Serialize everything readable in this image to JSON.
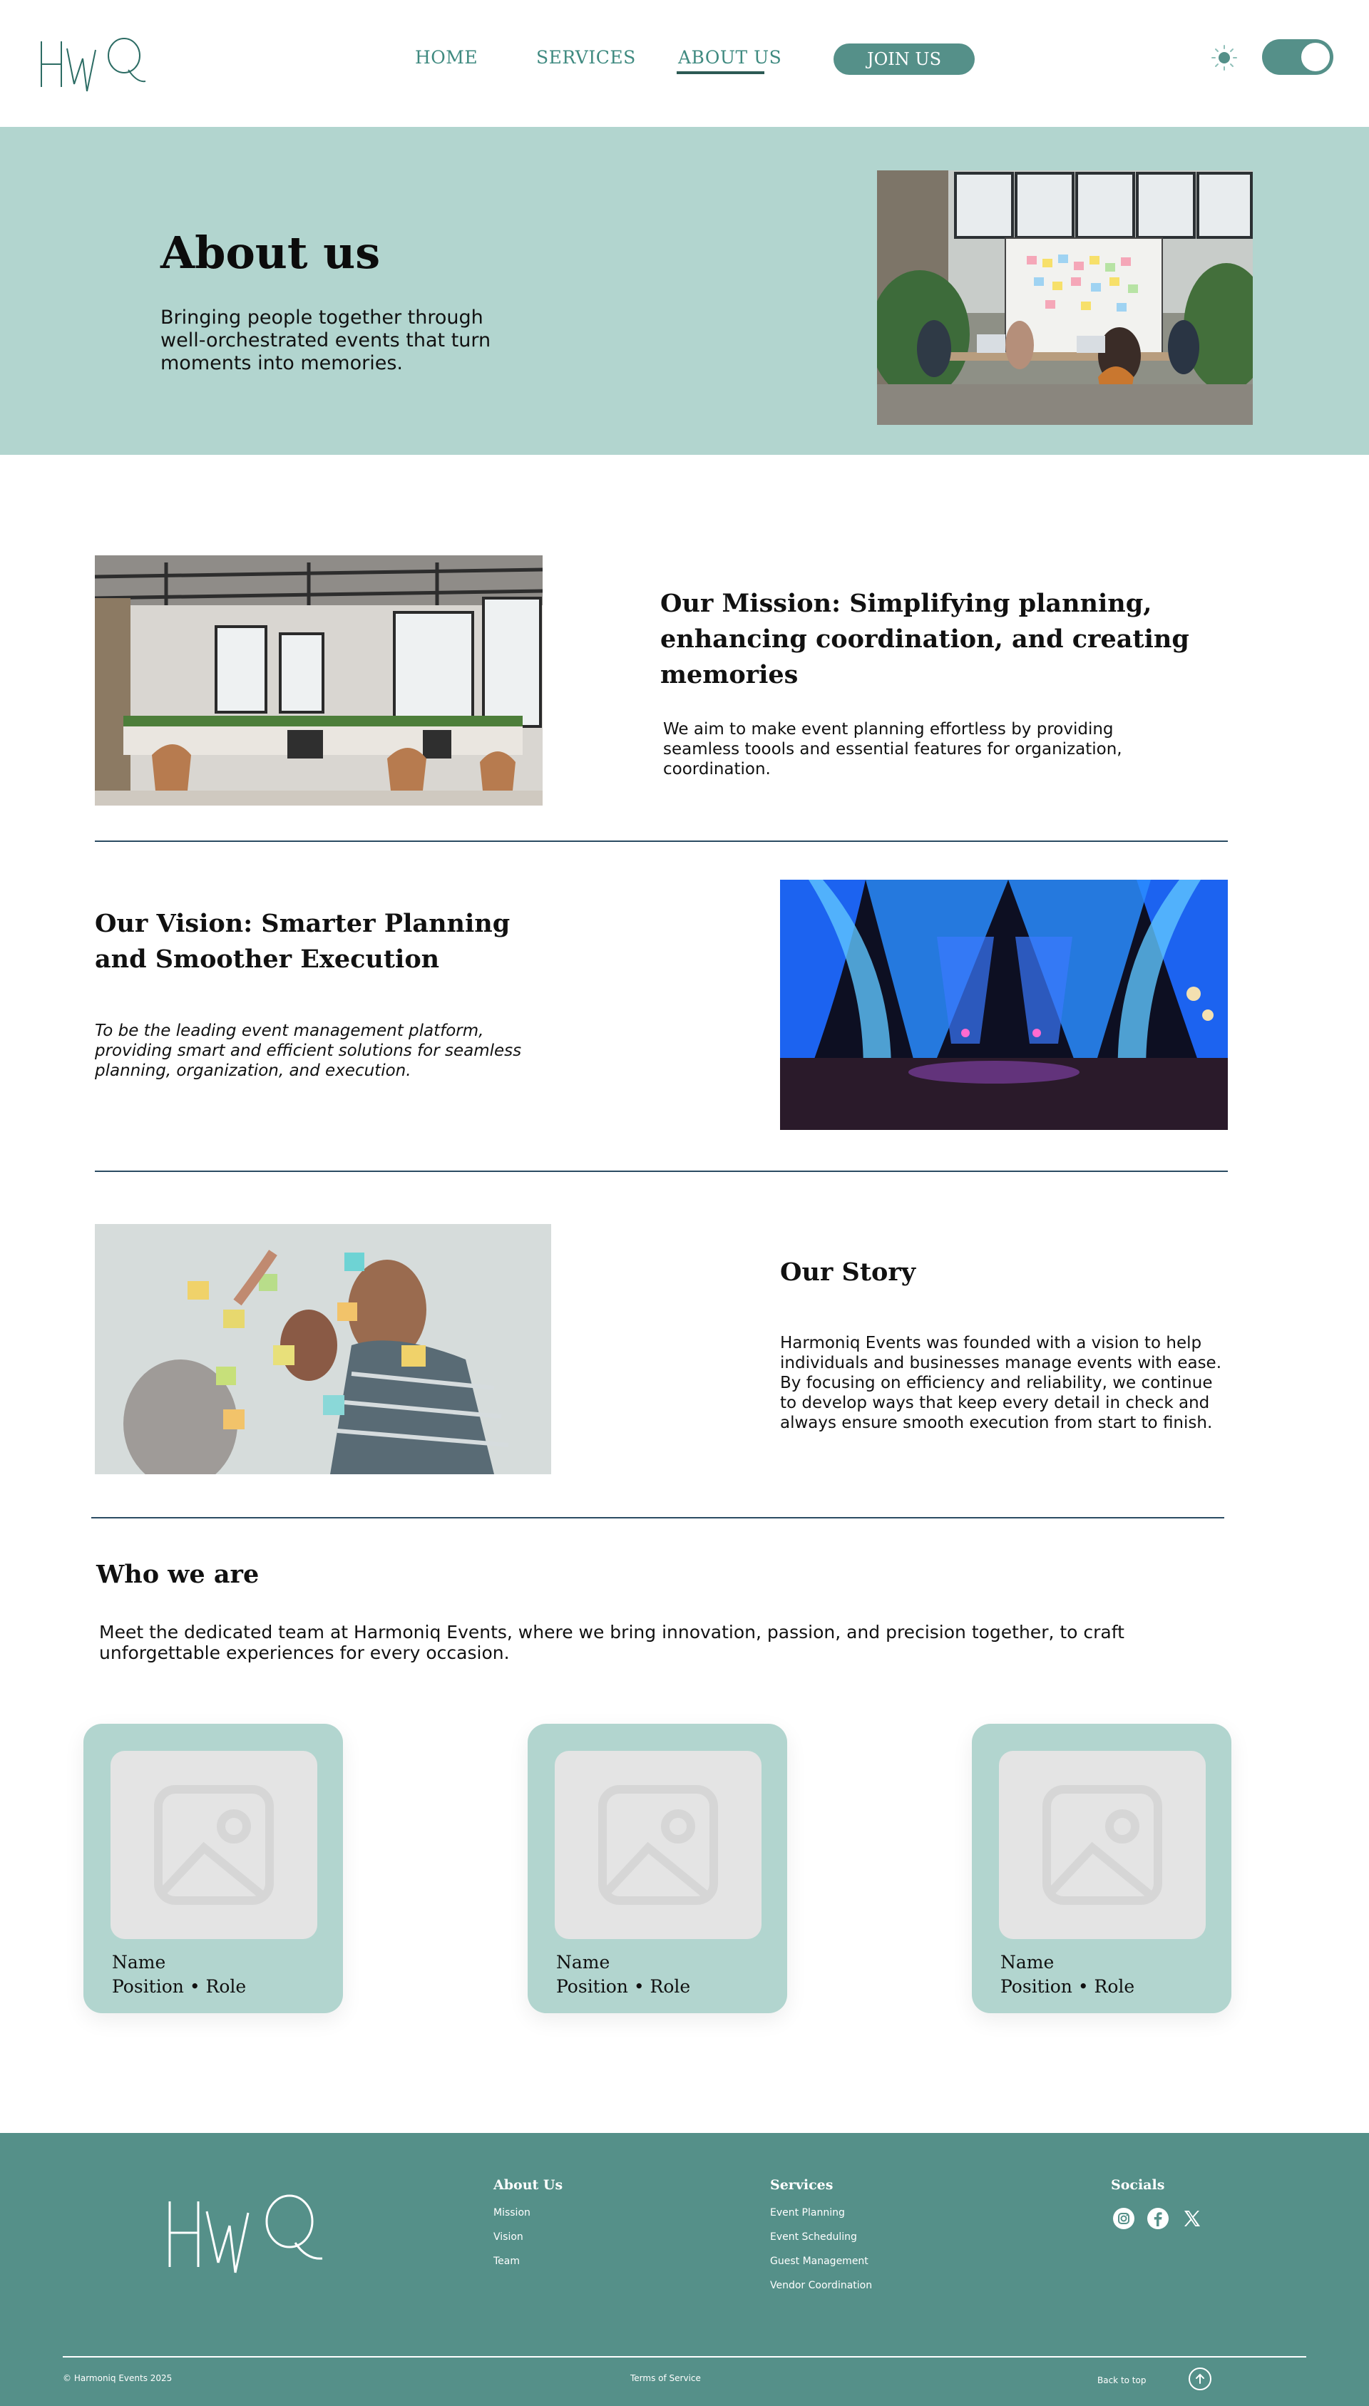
{
  "header": {
    "nav": [
      {
        "label": "HOME"
      },
      {
        "label": "SERVICES"
      },
      {
        "label": "ABOUT US"
      }
    ],
    "join_label": "JOIN US"
  },
  "hero": {
    "title": "About us",
    "subtitle": "Bringing people together through well-orchestrated events that turn moments into memories."
  },
  "mission": {
    "heading": "Our Mission: Simplifying planning, enhancing coordination, and creating memories",
    "text": "We aim to make event planning effortless by providing seamless toools and essential features for organization, coordination."
  },
  "vision": {
    "heading": "Our Vision: Smarter Planning and Smoother Execution",
    "text": "To be the leading event management platform, providing smart and efficient solutions for seamless planning, organization, and execution."
  },
  "story": {
    "heading": "Our Story",
    "text": "Harmoniq Events was founded with a vision to help individuals and businesses manage events with ease. By focusing on efficiency and reliability, we continue to develop ways that keep every detail in check and always ensure smooth execution from start to finish."
  },
  "team": {
    "heading": "Who we are",
    "intro": "Meet the dedicated team at Harmoniq Events, where we bring innovation, passion, and precision together, to craft unforgettable experiences for every occasion.",
    "members": [
      {
        "name": "Name",
        "role": "Position • Role"
      },
      {
        "name": "Name",
        "role": "Position • Role"
      },
      {
        "name": "Name",
        "role": "Position • Role"
      }
    ]
  },
  "footer": {
    "about": {
      "heading": "About Us",
      "links": [
        "Mission",
        "Vision",
        "Team"
      ]
    },
    "services": {
      "heading": "Services",
      "links": [
        "Event Planning",
        "Event Scheduling",
        "Guest Management",
        "Vendor Coordination"
      ]
    },
    "socials": {
      "heading": "Socials",
      "icons": [
        "instagram-icon",
        "facebook-icon",
        "x-icon"
      ]
    },
    "copyright": "© Harmoniq Events 2025",
    "terms": "Terms of Service",
    "back_to_top": "Back to top"
  },
  "colors": {
    "brand_teal": "#559089",
    "light_teal": "#b2d5cf",
    "nav_text": "#3f8a80",
    "rule": "#2b4c63"
  }
}
